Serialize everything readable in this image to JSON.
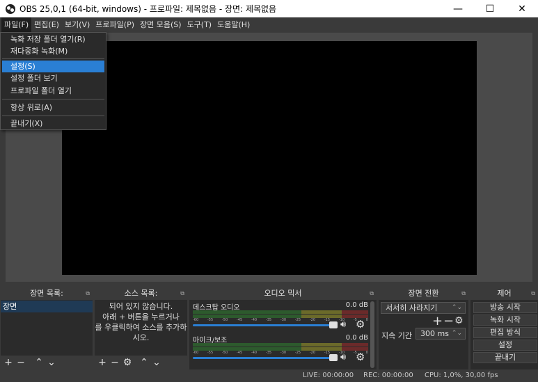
{
  "window": {
    "title": "OBS 25,0,1 (64-bit, windows) - 프로파일: 제목없음 - 장면: 제목없음",
    "minimize": "—",
    "maximize": "☐",
    "close": "✕"
  },
  "menubar": [
    "파일(F)",
    "편집(E)",
    "보기(V)",
    "프로파일(P)",
    "장면 모음(S)",
    "도구(T)",
    "도움말(H)"
  ],
  "file_menu": {
    "items": [
      "녹화 저장 폴더 열기(R)",
      "재다중화 녹화(M)",
      "설정(S)",
      "설정 폴더 보기",
      "프로파일 폴더 열기",
      "항상 위로(A)",
      "끝내기(X)"
    ],
    "active_index": 2
  },
  "docks": {
    "scenes": {
      "title": "장면 목록:",
      "items": [
        "장면"
      ]
    },
    "sources": {
      "title": "소스 목록:",
      "empty_text": [
        "되어 있지 않습니다.",
        "아래 + 버튼을 누르거나",
        "를 우클릭하여 소스를 추가하",
        "시오."
      ]
    },
    "mixer": {
      "title": "오디오 믹서",
      "channels": [
        {
          "name": "데스크탑 오디오",
          "db": "0.0 dB"
        },
        {
          "name": "마이크/보조",
          "db": "0.0 dB"
        }
      ],
      "ticks": [
        "-60",
        "-55",
        "-50",
        "-45",
        "-40",
        "-35",
        "-30",
        "-25",
        "-20",
        "-15",
        "-10",
        "-5",
        "0"
      ]
    },
    "transitions": {
      "title": "장면 전환",
      "selected": "서서히 사라지기",
      "duration_label": "지속 기간",
      "duration_value": "300 ms"
    },
    "controls": {
      "title": "제어",
      "buttons": [
        "방송 시작",
        "녹화 시작",
        "편집 방식",
        "설정",
        "끝내기"
      ]
    }
  },
  "statusbar": {
    "live": "LIVE: 00:00:00",
    "rec": "REC: 00:00:00",
    "cpu": "CPU: 1,0%, 30,00 fps"
  },
  "colors": {
    "accent": "#2a7fd4",
    "background": "#3a3a3a",
    "panel": "#2b2b2b"
  }
}
